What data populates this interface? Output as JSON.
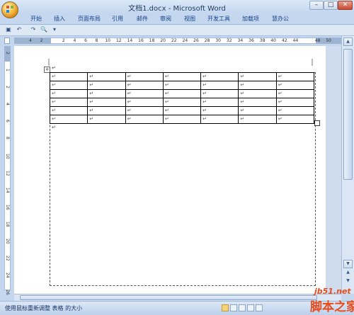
{
  "window": {
    "title": "文档1.docx - Microsoft Word",
    "minimize": "–",
    "maximize": "□",
    "close": "✕"
  },
  "ribbon": {
    "tabs": [
      "开始",
      "插入",
      "页面布局",
      "引用",
      "邮件",
      "审阅",
      "视图",
      "开发工具",
      "加载项",
      "慧办公"
    ]
  },
  "quick_access": {
    "icons": [
      "save-icon",
      "undo-icon",
      "redo-icon",
      "print-preview-icon",
      "customize-icon"
    ],
    "glyphs": [
      "▣",
      "↶",
      "↷",
      "🔍",
      "▾"
    ]
  },
  "ruler": {
    "horizontal_ticks": [
      "4",
      "2",
      "",
      "2",
      "4",
      "6",
      "8",
      "10",
      "12",
      "14",
      "16",
      "18",
      "20",
      "22",
      "24",
      "26",
      "28",
      "30",
      "32",
      "34",
      "36",
      "38",
      "40",
      "42",
      "44",
      "",
      "48",
      "50"
    ],
    "vertical_ticks": [
      "2",
      "1",
      "2",
      "4",
      "6",
      "8",
      "10",
      "12",
      "14",
      "16",
      "18",
      "20",
      "22",
      "24",
      "26"
    ]
  },
  "document": {
    "paragraph_mark": "↵",
    "table_move_handle": "+",
    "table": {
      "rows": 6,
      "cols": 7,
      "cell_text": "↵"
    }
  },
  "scrollbar": {
    "up": "▲",
    "down": "▼",
    "prev_page": "▲",
    "next_page": "▼"
  },
  "status": {
    "text": "使用鼠标重新调整 表格 的大小"
  },
  "watermark": {
    "site": "jb51.net",
    "name": "脚本之家"
  },
  "colors": {
    "ribbon_bg": "#c5d7ee",
    "tab_text": "#15428b",
    "watermark": "#e84a1a"
  }
}
